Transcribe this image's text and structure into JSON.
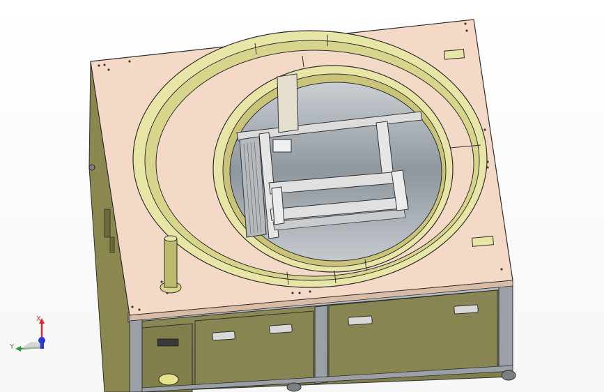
{
  "view": {
    "background": "#ffffff"
  },
  "colors": {
    "panel": "#f5d9c7",
    "panel_edge": "#3a3a3a",
    "ring_face": "#e8e6a6",
    "ring_inner": "#d7d48c",
    "ring_shadow": "#a9a55c",
    "cabinet": "#8c8a55",
    "cabinet_dark": "#5e5c33",
    "frame_steel": "#dcdcdc",
    "frame_dark": "#6f7378",
    "hole": "#9aa2a8"
  },
  "triad": {
    "x_label": "X",
    "y_label": "Y",
    "x_color": "#e0262a",
    "y_color": "#2a9a2a",
    "z_color": "#2a3ad0"
  }
}
